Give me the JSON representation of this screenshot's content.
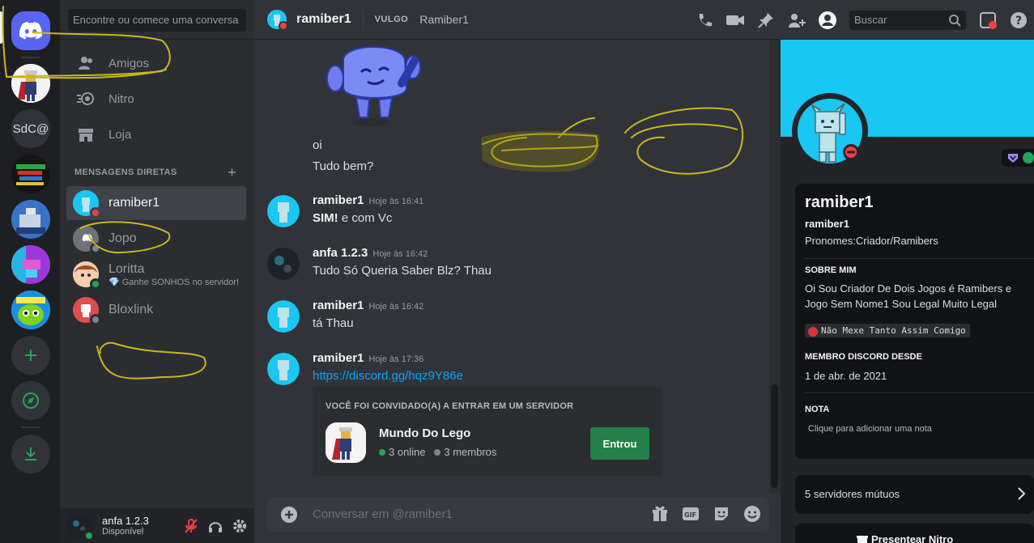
{
  "servers": [
    {
      "name": "home",
      "icon": "discord-logo-icon"
    },
    {
      "name": "thor-server",
      "icon": "thor-avatar"
    },
    {
      "name": "sdc-server",
      "label": "SdC@"
    },
    {
      "name": "server-4"
    },
    {
      "name": "server-5"
    },
    {
      "name": "server-6"
    },
    {
      "name": "dolem-server"
    }
  ],
  "dm_sidebar": {
    "search_placeholder": "Encontre ou comece uma conversa",
    "nav": [
      {
        "label": "Amigos",
        "icon": "friends-icon"
      },
      {
        "label": "Nitro",
        "icon": "nitro-icon"
      },
      {
        "label": "Loja",
        "icon": "shop-icon"
      }
    ],
    "dm_header": "MENSAGENS DIRETAS",
    "dms": [
      {
        "name": "ramiber1",
        "status": "dnd"
      },
      {
        "name": "Jopo",
        "status": "offline"
      },
      {
        "name": "Loritta",
        "sub": "💎 Ganhe SONHOS no servidor!",
        "status": "online"
      },
      {
        "name": "Bloxlink",
        "status": "offline"
      }
    ]
  },
  "user_panel": {
    "name": "anfa 1.2.3",
    "status": "Disponível"
  },
  "header": {
    "name": "ramiber1",
    "vulgo_label": "VULGO",
    "alias": "Ramiber1",
    "search_placeholder": "Buscar"
  },
  "chat": {
    "lines": [
      "oi",
      "Tudo bem?"
    ],
    "messages": [
      {
        "author": "ramiber1",
        "time": "Hoje às 16:41",
        "bold": "SIM!",
        "text": " e com Vc"
      },
      {
        "author": "anfa 1.2.3",
        "time": "Hoje às 16:42",
        "text": "Tudo Só Queria Saber Blz? Thau"
      },
      {
        "author": "ramiber1",
        "time": "Hoje às 16:42",
        "text": "tá Thau"
      },
      {
        "author": "ramiber1",
        "time": "Hoje às 17:36",
        "link": "https://discord.gg/hqz9Y86e"
      }
    ],
    "invite": {
      "header": "VOCÊ FOI CONVIDADO(A) A ENTRAR EM UM SERVIDOR",
      "server_name": "Mundo Do Lego",
      "online": "3 online",
      "members": "3 membros",
      "button": "Entrou"
    },
    "composer_placeholder": "Conversar em @ramiber1"
  },
  "profile": {
    "display_name": "ramiber1",
    "username": "ramiber1",
    "pronouns": "Pronomes:Criador/Ramibers",
    "about_title": "SOBRE MIM",
    "about_text": "Oi Sou Criador De Dois Jogos é Ramibers e Jogo Sem Nome1 Sou Legal Muito Legal",
    "code_chip": "Não Mexe Tanto Assim Comigo",
    "member_since_title": "MEMBRO DISCORD DESDE",
    "member_since": "1 de abr. de 2021",
    "note_title": "NOTA",
    "note_placeholder": "Clique para adicionar uma nota",
    "mutual_servers": "5 servidores mútuos",
    "gift_label": "Presentear Nitro"
  },
  "colors": {
    "blurple": "#5865f2",
    "online": "#23a55a",
    "dnd": "#f23f43",
    "offline": "#80848e",
    "link": "#00a8fc",
    "banner": "#19c7f2",
    "scribble": "#c9b81e"
  }
}
